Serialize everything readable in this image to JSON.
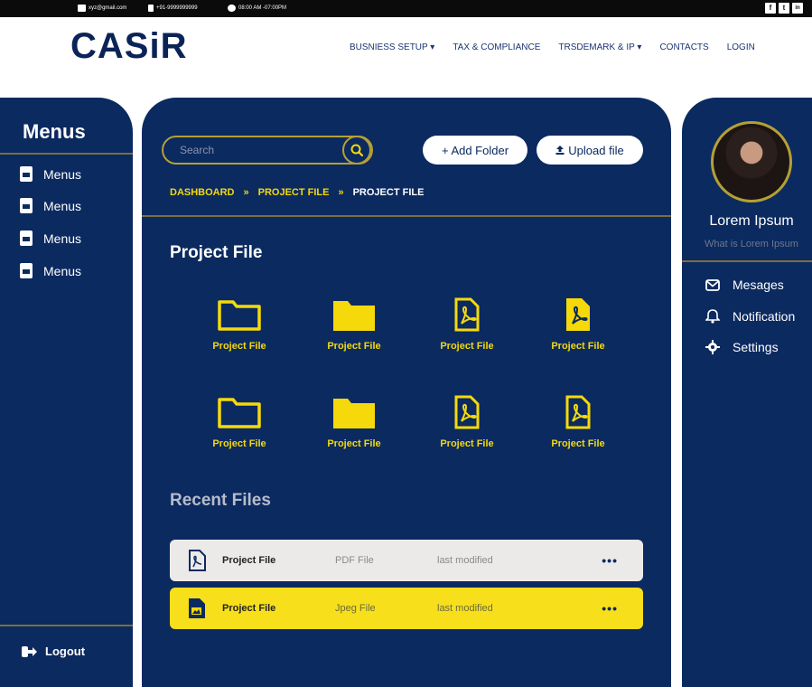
{
  "topbar": {
    "email": "xyz@gmail.com",
    "phone": "+91-9999999999",
    "hours": "08:00 AM -07:00PM",
    "social": [
      "f",
      "t",
      "in"
    ]
  },
  "navbar": {
    "logo": "CASiR",
    "items": [
      "BUSNIESS SETUP ▾",
      "TAX & COMPLIANCE",
      "TRSDEMARK & IP ▾",
      "CONTACTS",
      "LOGIN"
    ]
  },
  "left": {
    "title": "Menus",
    "items": [
      "Menus",
      "Menus",
      "Menus",
      "Menus"
    ],
    "logout": "Logout"
  },
  "center": {
    "search_placeholder": "Search",
    "add_folder": "+ Add Folder",
    "upload_file": "Upload file",
    "breadcrumb": [
      "DASHBOARD",
      "»",
      "PROJECT FILE",
      "»",
      "PROJECT FILE"
    ],
    "grid_title": "Project File",
    "tiles": [
      {
        "label": "Project File",
        "icon": "folder-outline-icon"
      },
      {
        "label": "Project File",
        "icon": "folder-filled-icon"
      },
      {
        "label": "Project File",
        "icon": "pdf-outline-icon"
      },
      {
        "label": "Project File",
        "icon": "pdf-filled-icon"
      },
      {
        "label": "Project File",
        "icon": "folder-outline-icon"
      },
      {
        "label": "Project File",
        "icon": "folder-filled-icon"
      },
      {
        "label": "Project File",
        "icon": "pdf-outline-icon"
      },
      {
        "label": "Project File",
        "icon": "pdf-outline-icon"
      }
    ],
    "recent_title": "Recent Files",
    "recent": [
      {
        "name": "Project File",
        "type": "PDF File",
        "modified": "last modified",
        "menu": "•••"
      },
      {
        "name": "Project File",
        "type": "Jpeg  File",
        "modified": "last modified",
        "menu": "•••"
      }
    ]
  },
  "right": {
    "name": "Lorem Ipsum",
    "subtitle": "What is Lorem Ipsum",
    "items": [
      "Mesages",
      "Notification",
      "Settings"
    ]
  },
  "colors": {
    "navy": "#0b2a60",
    "yellow": "#f5d90a",
    "gold_line": "#7c6f3e"
  }
}
